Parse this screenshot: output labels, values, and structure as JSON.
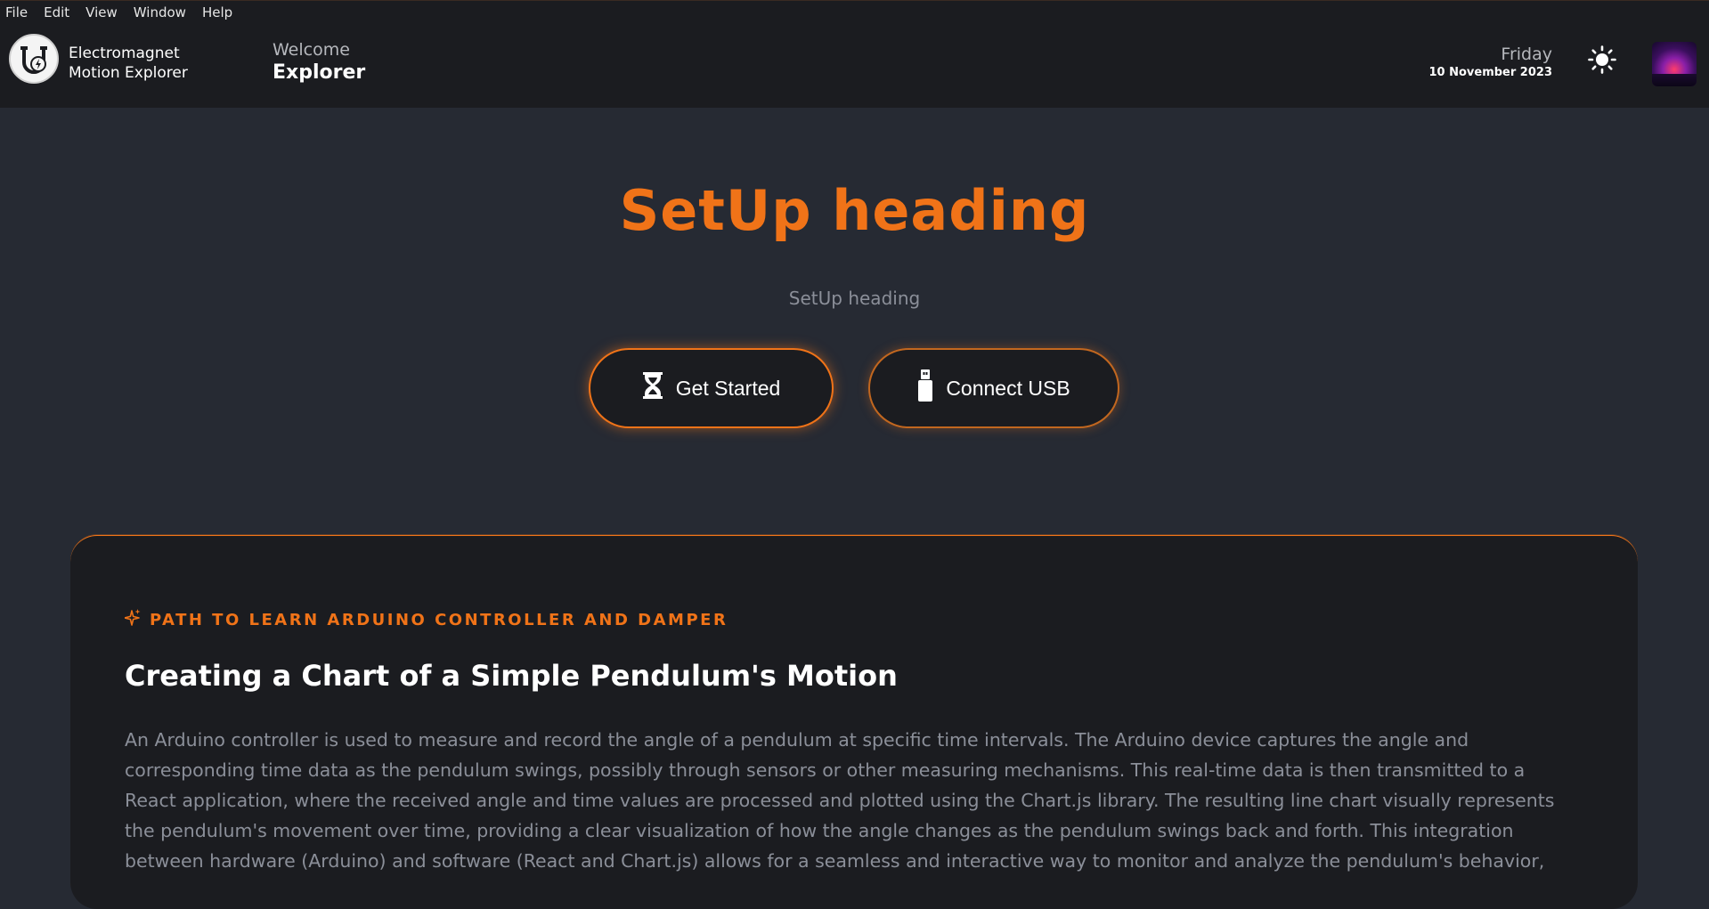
{
  "menubar": {
    "items": [
      "File",
      "Edit",
      "View",
      "Window",
      "Help"
    ]
  },
  "header": {
    "brand_line1": "Electromagnet",
    "brand_line2": "Motion Explorer",
    "welcome_label": "Welcome",
    "welcome_name": "Explorer",
    "day": "Friday",
    "date": "10 November 2023",
    "theme_icon": "sun-icon",
    "avatar_icon": "avatar-image"
  },
  "hero": {
    "title": "SetUp heading",
    "subtitle": "SetUp heading",
    "get_started_label": "Get Started",
    "get_started_icon": "hourglass-icon",
    "connect_usb_label": "Connect USB",
    "connect_usb_icon": "usb-icon"
  },
  "card": {
    "kicker": "PATH TO LEARN ARDUINO CONTROLLER AND DAMPER",
    "kicker_icon": "sparkle-icon",
    "title": "Creating a Chart of a Simple Pendulum's Motion",
    "body": "An Arduino controller is used to measure and record the angle of a pendulum at specific time intervals. The Arduino device captures the angle and corresponding time data as the pendulum swings, possibly through sensors or other measuring mechanisms. This real-time data is then transmitted to a React application, where the received angle and time values are processed and plotted using the Chart.js library. The resulting line chart visually represents the pendulum's movement over time, providing a clear visualization of how the angle changes as the pendulum swings back and forth. This integration between hardware (Arduino) and software (React and Chart.js) allows for a seamless and interactive way to monitor and analyze the pendulum's behavior,"
  },
  "colors": {
    "accent": "#f07318",
    "background": "#262a33",
    "surface": "#1b1c20",
    "muted_text": "#8b8f99"
  }
}
